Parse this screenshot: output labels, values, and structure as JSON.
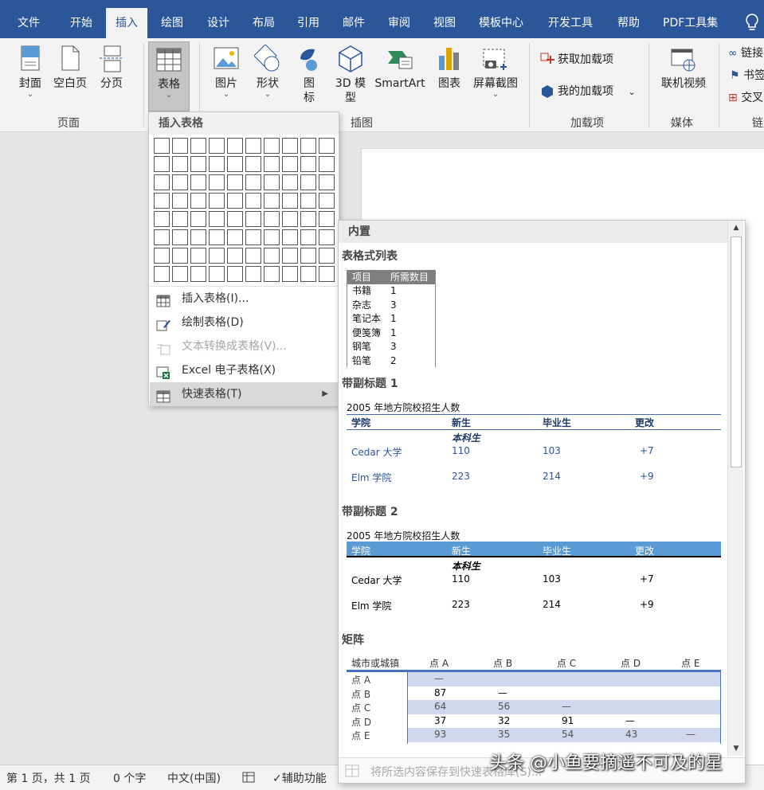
{
  "menubar": {
    "tabs": [
      {
        "label": "文件"
      },
      {
        "label": "开始"
      },
      {
        "label": "插入"
      },
      {
        "label": "绘图"
      },
      {
        "label": "设计"
      },
      {
        "label": "布局"
      },
      {
        "label": "引用"
      },
      {
        "label": "邮件"
      },
      {
        "label": "审阅"
      },
      {
        "label": "视图"
      },
      {
        "label": "模板中心"
      },
      {
        "label": "开发工具"
      },
      {
        "label": "帮助"
      },
      {
        "label": "PDF工具集"
      }
    ],
    "active_tab": "插入",
    "bulb_icon": "lightbulb-icon"
  },
  "ribbon": {
    "pages_group": {
      "label": "页面",
      "cover": "封面",
      "blank_page": "空白页",
      "page_break": "分页"
    },
    "table_button": {
      "label": "表格"
    },
    "illustrations_group": {
      "label": "插图",
      "pictures": "图片",
      "shapes": "形状",
      "icons": "图\n标",
      "model_3d": "3D 模\n型",
      "smartart": "SmartArt",
      "chart": "图表",
      "screenshot": "屏幕截图"
    },
    "addins_group": {
      "label": "加载项",
      "get_addins": "获取加载项",
      "my_addins": "我的加载项"
    },
    "media_group": {
      "label": "媒体",
      "online_video": "联机视频"
    },
    "links_group": {
      "label": "链",
      "link": "链接",
      "bookmark": "书签",
      "cross_ref": "交叉"
    }
  },
  "table_menu": {
    "header": "插入表格",
    "grid_cols": 10,
    "grid_rows": 8,
    "items": [
      {
        "label": "插入表格(I)...",
        "enabled": true
      },
      {
        "label": "绘制表格(D)",
        "enabled": true
      },
      {
        "label": "文本转换成表格(V)...",
        "enabled": false
      },
      {
        "label": "Excel 电子表格(X)",
        "enabled": true
      },
      {
        "label": "快速表格(T)",
        "enabled": true,
        "highlighted": true,
        "submenu": true
      }
    ]
  },
  "quick_tables": {
    "header": "内置",
    "tabular_list": {
      "title": "表格式列表",
      "headers": [
        "项目",
        "所需数目"
      ],
      "rows": [
        [
          "书籍",
          "1"
        ],
        [
          "杂志",
          "3"
        ],
        [
          "笔记本",
          "1"
        ],
        [
          "便笺簿",
          "1"
        ],
        [
          "钢笔",
          "3"
        ],
        [
          "铅笔",
          "2"
        ]
      ]
    },
    "with_subheads_1": {
      "title": "带副标题 1",
      "caption": "2005  年地方院校招生人数",
      "headers": [
        "学院",
        "新生",
        "毕业生",
        "更改"
      ],
      "subhead": "本科生",
      "rows": [
        [
          "Cedar 大学",
          "110",
          "103",
          "+7"
        ],
        [
          "Elm 学院",
          "223",
          "214",
          "+9"
        ]
      ]
    },
    "with_subheads_2": {
      "title": "带副标题 2",
      "caption": "2005  年地方院校招生人数",
      "headers": [
        "学院",
        "新生",
        "毕业生",
        "更改"
      ],
      "subhead": "本科生",
      "rows": [
        [
          "Cedar 大学",
          "110",
          "103",
          "+7"
        ],
        [
          "Elm 学院",
          "223",
          "214",
          "+9"
        ]
      ]
    },
    "matrix": {
      "title": "矩阵",
      "headers": [
        "城市或城镇",
        "点  A",
        "点  B",
        "点  C",
        "点  D",
        "点  E"
      ],
      "rows": [
        [
          "点  A",
          "—",
          "",
          "",
          "",
          ""
        ],
        [
          "点  B",
          "87",
          "—",
          "",
          "",
          ""
        ],
        [
          "点  C",
          "64",
          "56",
          "—",
          "",
          ""
        ],
        [
          "点  D",
          "37",
          "32",
          "91",
          "—",
          ""
        ],
        [
          "点  E",
          "93",
          "35",
          "54",
          "43",
          "—"
        ]
      ]
    },
    "footer": "将所选内容保存到快速表格库(S)..."
  },
  "statusbar": {
    "page": "第 1 页，共 1 页",
    "words": "0 个字",
    "language": "中文(中国)",
    "accessibility": "辅助功能"
  },
  "watermark": "头条 @小鱼要摘遥不可及的星",
  "colors": {
    "brand": "#2b579a",
    "matrix_header_line": "#4472c4",
    "matrix_band": "#cfd8ee",
    "subhead2_band": "#5b9bd5"
  }
}
